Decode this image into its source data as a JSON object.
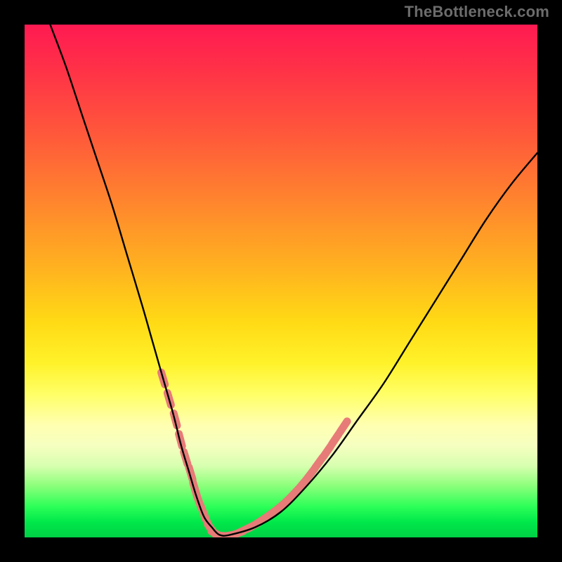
{
  "watermark_text": "TheBottleneck.com",
  "chart_data": {
    "type": "line",
    "title": "",
    "xlabel": "",
    "ylabel": "",
    "xlim": [
      0,
      100
    ],
    "ylim": [
      0,
      100
    ],
    "legend": false,
    "background_gradient": {
      "direction": "vertical",
      "stops": [
        {
          "pos": 0,
          "color": "#ff1a52"
        },
        {
          "pos": 22,
          "color": "#ff5a3a"
        },
        {
          "pos": 48,
          "color": "#ffb41f"
        },
        {
          "pos": 66,
          "color": "#fff22a"
        },
        {
          "pos": 82,
          "color": "#f6ffc0"
        },
        {
          "pos": 94,
          "color": "#2cff58"
        },
        {
          "pos": 100,
          "color": "#00d045"
        }
      ]
    },
    "series": [
      {
        "name": "v-curve",
        "color": "#000000",
        "x": [
          5,
          8,
          11,
          14,
          17,
          20,
          23,
          25,
          27,
          29,
          30.5,
          32,
          33.5,
          35,
          36.5,
          38,
          40,
          45,
          50,
          55,
          60,
          65,
          70,
          75,
          80,
          85,
          90,
          95,
          100
        ],
        "y": [
          100,
          92,
          83,
          74,
          65,
          55,
          45,
          38,
          31,
          24,
          18,
          13,
          8,
          4,
          2,
          0.5,
          0.5,
          2,
          5,
          10,
          16,
          23,
          30,
          38,
          46,
          54,
          62,
          69,
          75
        ]
      }
    ],
    "markers": {
      "name": "highlight-beads",
      "shape": "rounded-capsule",
      "color": "#e77b78",
      "points": [
        {
          "x": 27.0,
          "y": 31.0
        },
        {
          "x": 28.2,
          "y": 27.0
        },
        {
          "x": 29.4,
          "y": 23.0
        },
        {
          "x": 30.4,
          "y": 19.0
        },
        {
          "x": 31.4,
          "y": 15.5
        },
        {
          "x": 32.4,
          "y": 12.5
        },
        {
          "x": 33.2,
          "y": 9.5
        },
        {
          "x": 34.0,
          "y": 7.0
        },
        {
          "x": 34.8,
          "y": 5.0
        },
        {
          "x": 35.6,
          "y": 3.0
        },
        {
          "x": 36.5,
          "y": 1.5
        },
        {
          "x": 37.5,
          "y": 0.6
        },
        {
          "x": 38.7,
          "y": 0.3
        },
        {
          "x": 40.0,
          "y": 0.4
        },
        {
          "x": 41.5,
          "y": 0.8
        },
        {
          "x": 43.0,
          "y": 1.5
        },
        {
          "x": 44.6,
          "y": 2.3
        },
        {
          "x": 46.2,
          "y": 3.3
        },
        {
          "x": 47.8,
          "y": 4.4
        },
        {
          "x": 49.4,
          "y": 5.6
        },
        {
          "x": 51.0,
          "y": 7.0
        },
        {
          "x": 52.6,
          "y": 8.6
        },
        {
          "x": 54.2,
          "y": 10.4
        },
        {
          "x": 55.8,
          "y": 12.4
        },
        {
          "x": 57.4,
          "y": 14.6
        },
        {
          "x": 59.0,
          "y": 16.8
        },
        {
          "x": 60.6,
          "y": 19.2
        },
        {
          "x": 62.2,
          "y": 21.6
        }
      ]
    }
  }
}
